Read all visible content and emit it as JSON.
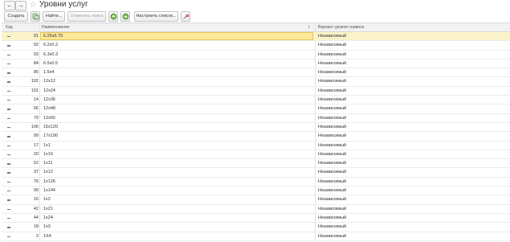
{
  "window": {
    "title": "Уровни услуг",
    "back_icon": "←",
    "forward_icon": "→",
    "favorite_icon": "☆"
  },
  "toolbar": {
    "create_label": "Создать",
    "find_label": "Найти...",
    "cancel_search_label": "Отменить поиск",
    "customize_list_label": "Настроить список..."
  },
  "table": {
    "columns": {
      "code": "Код",
      "name": "Наименование",
      "variant": "Вариант уровня сервиса",
      "info_icon": "i"
    },
    "selected_index": 0,
    "rows": [
      {
        "code": "91",
        "name": "6.25x6.75",
        "variant": "Независимый"
      },
      {
        "code": "92",
        "name": "6.2x0.2",
        "variant": "Независимый"
      },
      {
        "code": "93",
        "name": "6.3x0.3",
        "variant": "Независимый"
      },
      {
        "code": "84",
        "name": "6.5x0.5",
        "variant": "Независимый"
      },
      {
        "code": "86",
        "name": "1.5x4",
        "variant": "Независимый"
      },
      {
        "code": "192",
        "name": "12x12",
        "variant": "Независимый"
      },
      {
        "code": "191",
        "name": "12x24",
        "variant": "Независимый"
      },
      {
        "code": "14",
        "name": "12x36",
        "variant": "Независимый"
      },
      {
        "code": "56",
        "name": "12x48",
        "variant": "Независимый"
      },
      {
        "code": "79",
        "name": "12x55",
        "variant": "Независимый"
      },
      {
        "code": "106",
        "name": "15x120",
        "variant": "Независимый"
      },
      {
        "code": "99",
        "name": "17x190",
        "variant": "Независимый"
      },
      {
        "code": "17",
        "name": "1x1",
        "variant": "Независимый"
      },
      {
        "code": "20",
        "name": "1x16",
        "variant": "Независимый"
      },
      {
        "code": "52",
        "name": "1x11",
        "variant": "Независимый"
      },
      {
        "code": "37",
        "name": "1x12",
        "variant": "Независимый"
      },
      {
        "code": "76",
        "name": "1x126",
        "variant": "Независимый"
      },
      {
        "code": "90",
        "name": "1x144",
        "variant": "Независимый"
      },
      {
        "code": "16",
        "name": "1x2",
        "variant": "Независимый"
      },
      {
        "code": "42",
        "name": "1x21",
        "variant": "Независимый"
      },
      {
        "code": "44",
        "name": "1x24",
        "variant": "Независимый"
      },
      {
        "code": "18",
        "name": "1x3",
        "variant": "Независимый"
      },
      {
        "code": "2",
        "name": "1X4",
        "variant": "Независимый"
      }
    ]
  }
}
